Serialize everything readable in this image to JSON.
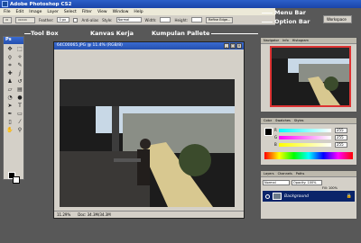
{
  "window": {
    "title": "Adobe Photoshop CS2"
  },
  "menu": {
    "items": [
      "File",
      "Edit",
      "Image",
      "Layer",
      "Select",
      "Filter",
      "View",
      "Window",
      "Help"
    ]
  },
  "options": {
    "feather_label": "Feather:",
    "feather_value": "0 px",
    "antialias_label": "Anti-alias",
    "style_label": "Style:",
    "style_value": "Normal",
    "width_label": "Width:",
    "height_label": "Height:",
    "refine_label": "Refine Edge...",
    "workspace_label": "Workspace"
  },
  "annotations": {
    "menu_bar": "Menu Bar",
    "option_bar": "Option Bar",
    "tool_box": "Tool Box",
    "kanvas_kerja": "Kanvas Kerja",
    "kumpulan_pallete": "Kumpulan Pallete"
  },
  "toolbox": {
    "title": "Ps",
    "tools": [
      "move-icon",
      "marquee-icon",
      "lasso-icon",
      "magic-wand-icon",
      "crop-icon",
      "slice-icon",
      "healing-icon",
      "brush-icon",
      "stamp-icon",
      "history-brush-icon",
      "eraser-icon",
      "gradient-icon",
      "blur-icon",
      "dodge-icon",
      "path-select-icon",
      "type-icon",
      "pen-icon",
      "shape-icon",
      "notes-icon",
      "eyedropper-icon",
      "hand-icon",
      "zoom-icon"
    ]
  },
  "document": {
    "title": "64C00065.JPG @ 11.4% (RGB/8)",
    "zoom": "11.29%",
    "doc_info": "Doc: 34.3M/34.3M"
  },
  "navigator": {
    "tabs": [
      "Navigator",
      "Info",
      "Histogram"
    ]
  },
  "color_panel": {
    "tabs": [
      "Color",
      "Swatches",
      "Styles"
    ],
    "r_label": "R",
    "g_label": "G",
    "b_label": "B",
    "r_value": "255",
    "g_value": "255",
    "b_value": "255"
  },
  "layers_panel": {
    "tabs": [
      "Layers",
      "Channels",
      "Paths"
    ],
    "blend_mode": "Normal",
    "opacity_label": "Opacity: 100%",
    "fill_label": "Fill: 100%",
    "layer_name": "Background"
  }
}
